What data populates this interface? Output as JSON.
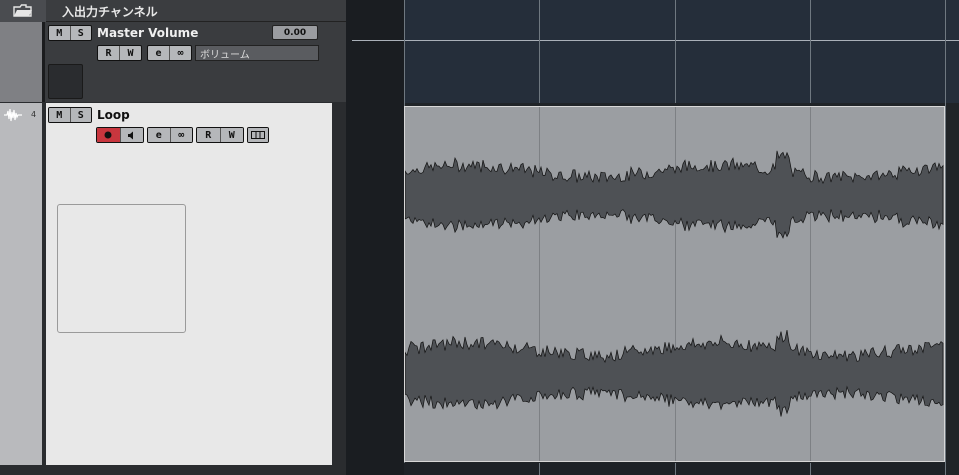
{
  "folder_track": {
    "title": "入出力チャンネル",
    "icon": "folder-open-icon"
  },
  "master_track": {
    "mute": "M",
    "solo": "S",
    "name": "Master Volume",
    "value": "0.00",
    "read": "R",
    "write": "W",
    "edit": "e",
    "link": "∞",
    "automation_param": "ボリューム"
  },
  "loop_track": {
    "number": "4",
    "mute": "M",
    "solo": "S",
    "name": "Loop",
    "record_icon": "record-icon",
    "monitor_icon": "speaker-icon",
    "edit": "e",
    "link": "∞",
    "read": "R",
    "write": "W",
    "lanes_icon": "lanes-icon",
    "type_icon": "waveform-icon"
  },
  "colors": {
    "record_active": "#c8363e",
    "event_bg": "#9b9ea2",
    "waveform": "#4e5155",
    "ruler_bg": "#252e3a"
  }
}
